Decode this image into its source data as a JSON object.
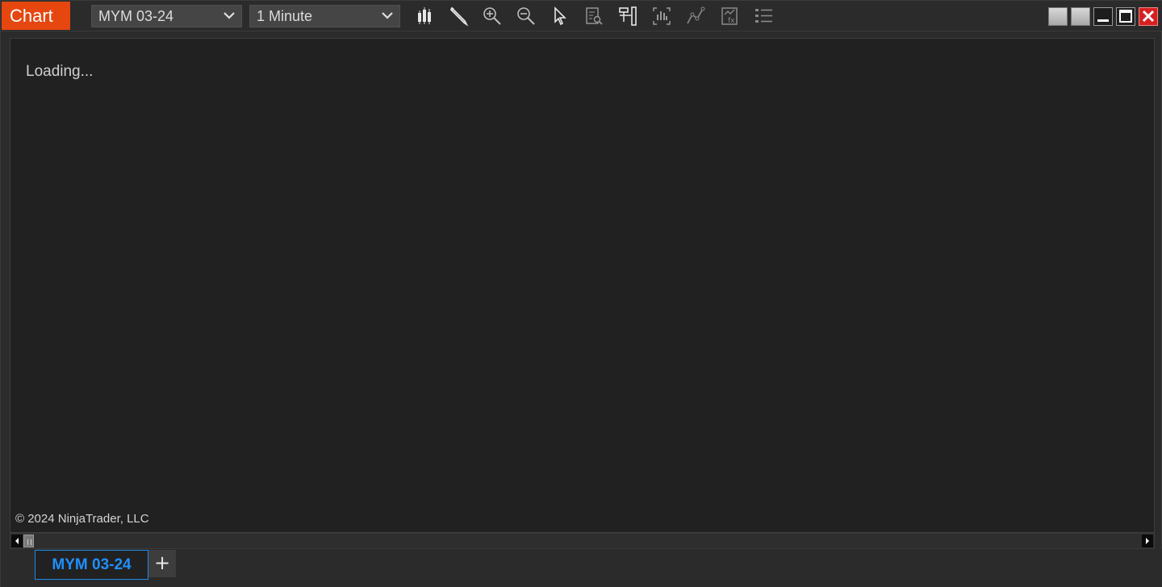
{
  "titlebar": {
    "app_title": "Chart",
    "instrument": "MYM 03-24",
    "interval": "1 Minute",
    "tools": [
      {
        "icon": "bars-icon"
      },
      {
        "icon": "pencil-icon"
      },
      {
        "icon": "zoom-in-icon"
      },
      {
        "icon": "zoom-out-icon"
      },
      {
        "icon": "pointer-icon"
      },
      {
        "icon": "data-box-icon"
      },
      {
        "icon": "chart-trader-icon"
      },
      {
        "icon": "indicators-icon"
      },
      {
        "icon": "strategies-icon"
      },
      {
        "icon": "properties-icon"
      },
      {
        "icon": "list-icon"
      }
    ],
    "window_buttons": [
      "tile-icon",
      "tile-icon",
      "minimize-icon",
      "maximize-icon",
      "close-icon"
    ]
  },
  "chart": {
    "status": "Loading...",
    "copyright": "© 2024 NinjaTrader, LLC"
  },
  "tabs": [
    {
      "label": "MYM 03-24",
      "active": true
    }
  ],
  "tab_add_label": "+",
  "colors": {
    "accent": "#e5470f",
    "tab_active": "#1e90ff",
    "close": "#d62020",
    "background": "#212121"
  }
}
